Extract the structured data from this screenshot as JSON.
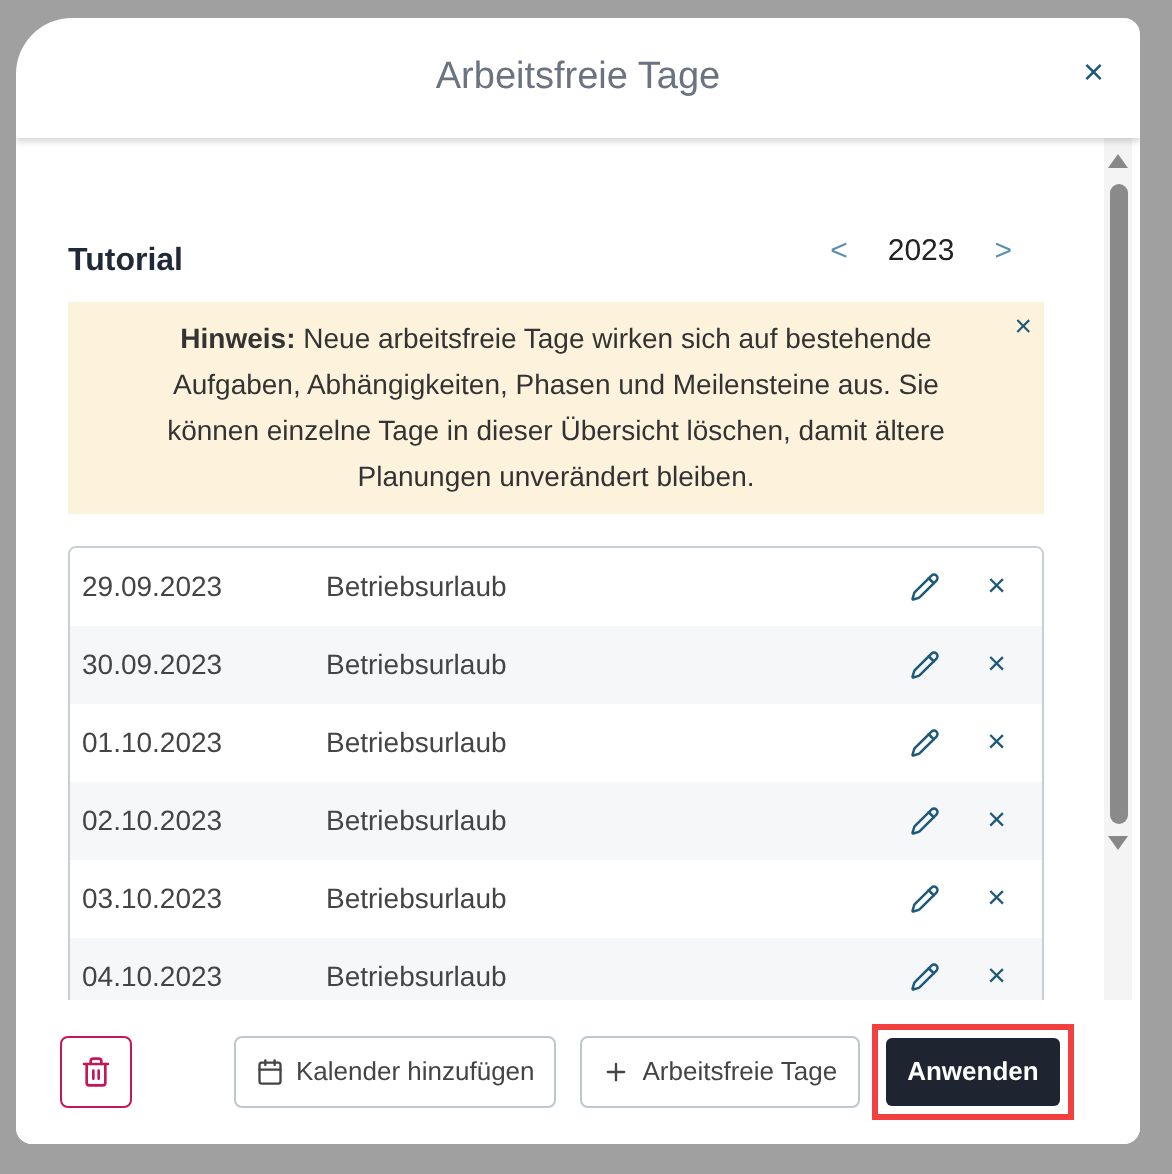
{
  "dialog": {
    "title": "Arbeitsfreie Tage",
    "close": "×"
  },
  "calendar": {
    "name": "Tutorial",
    "prev": "<",
    "year": "2023",
    "next": ">"
  },
  "notice": {
    "text": "**Hinweis:** Neue arbeitsfreie Tage wirken sich auf bestehende Aufgaben, Abhängigkeiten, Phasen und Meilensteine aus. Sie können einzelne Tage in dieser Übersicht löschen, damit ältere Planungen unverändert bleiben.",
    "close": "×"
  },
  "days": [
    {
      "date": "29.09.2023",
      "label": "Betriebsurlaub",
      "remove": "×"
    },
    {
      "date": "30.09.2023",
      "label": "Betriebsurlaub",
      "remove": "×"
    },
    {
      "date": "01.10.2023",
      "label": "Betriebsurlaub",
      "remove": "×"
    },
    {
      "date": "02.10.2023",
      "label": "Betriebsurlaub",
      "remove": "×"
    },
    {
      "date": "03.10.2023",
      "label": "Betriebsurlaub",
      "remove": "×"
    },
    {
      "date": "04.10.2023",
      "label": "Betriebsurlaub",
      "remove": "×"
    }
  ],
  "footer": {
    "add_calendar": "Kalender hinzufügen",
    "add_days": "Arbeitsfreie Tage",
    "apply": "Anwenden",
    "apply_highlighted": true
  }
}
